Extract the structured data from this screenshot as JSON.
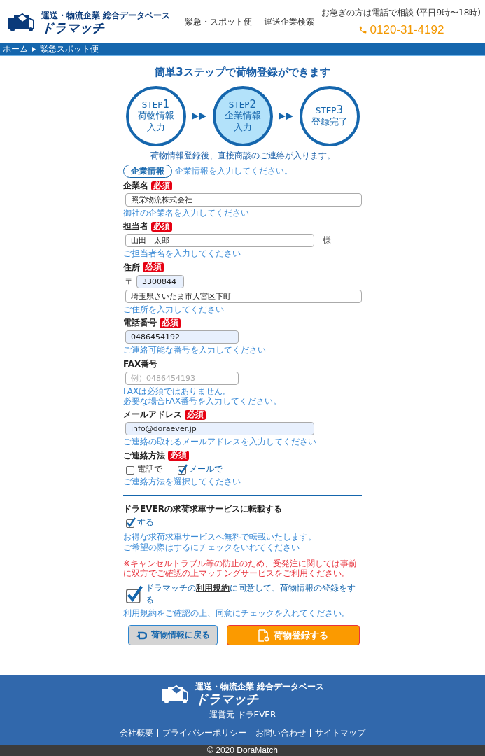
{
  "header": {
    "logo": {
      "tagline": "運送・物流企業 総合データベース",
      "name": "ドラマッチ"
    },
    "nav": [
      "緊急・スポット便",
      "運送企業検索"
    ],
    "contact": {
      "note": "お急ぎの方は電話で相談 (平日9時〜18時)",
      "phone": "0120-31-4192"
    }
  },
  "breadcrumb": [
    "ホーム",
    "緊急スポット便"
  ],
  "heading": "簡単3ステップで荷物登録ができます",
  "steps": [
    {
      "prefix": "STEP",
      "number": "1",
      "title": [
        "荷物情報",
        "入力"
      ],
      "selected": false
    },
    {
      "prefix": "STEP",
      "number": "2",
      "title": [
        "企業情報",
        "入力"
      ],
      "selected": true
    },
    {
      "prefix": "STEP",
      "number": "3",
      "title": [
        "登録完了"
      ],
      "selected": false
    }
  ],
  "step_note": "荷物情報登録後、直接商談のご連絡が入ります。",
  "section": {
    "title": "企業情報",
    "hint": "企業情報を入力してください。"
  },
  "fields": [
    {
      "label": "企業名",
      "badge": "必須",
      "inputs": [
        {
          "value": "照栄物流株式会社",
          "highlighted": false
        }
      ],
      "hints": [
        "御社の企業名を入力してください"
      ]
    },
    {
      "label": "担当者",
      "badge": "必須",
      "inputs": [
        {
          "value": "山田　太郎",
          "suffix": "様",
          "highlighted": false
        }
      ],
      "hints": [
        "ご担当者名を入力してください"
      ]
    },
    {
      "label": "住所",
      "badge": "必須",
      "inputs": [
        {
          "prefix": "〒",
          "value": "3300844",
          "highlighted": true
        },
        {
          "value": "埼玉県さいたま市大宮区下町",
          "highlighted": false
        }
      ],
      "hints": [
        "ご住所を入力してください"
      ]
    },
    {
      "label": "電話番号",
      "badge": "必須",
      "inputs": [
        {
          "value": "0486454192",
          "highlighted": true
        }
      ],
      "hints": [
        "ご連絡可能な番号を入力してください"
      ]
    },
    {
      "label": "FAX番号",
      "inputs": [
        {
          "placeholder": "例）0486454193",
          "highlighted": false
        }
      ],
      "hints": [
        "FAXは必須ではありません。",
        "必要な場合FAX番号を入力してください。"
      ]
    },
    {
      "label": "メールアドレス",
      "badge": "必須",
      "inputs": [
        {
          "value": "info@doraever.jp",
          "highlighted": true
        }
      ],
      "hints": [
        "ご連絡の取れるメールアドレスを入力してください"
      ]
    }
  ],
  "contact_method": {
    "label": "ご連絡方法",
    "badge": "必須",
    "options": [
      {
        "label": "電話で",
        "checked": false
      },
      {
        "label": "メールで",
        "checked": true
      }
    ],
    "hint": "ご連絡方法を選択してください"
  },
  "listing": {
    "title": "ドラEVERの求荷求車サービスに転載する",
    "option": {
      "label": "する",
      "checked": true
    },
    "hints": [
      "お得な求荷求車サービスへ無料で転載いたします。",
      "ご希望の際はするにチェックをいれてください"
    ],
    "warning": "※キャンセルトラブル等の防止のため、受発注に関しては事前に双方でご確認の上マッチングサービスをご利用ください。"
  },
  "agreement": {
    "checked": true,
    "before": "ドラマッチの",
    "link": "利用規約",
    "after": "に同意して、荷物情報の登録をする",
    "hint": "利用規約をご確認の上、同意にチェックを入れてください。"
  },
  "buttons": {
    "back": "荷物情報に戻る",
    "submit": "荷物登録する"
  },
  "footer": {
    "logo": {
      "tagline": "運送・物流企業 総合データベース",
      "name": "ドラマッチ"
    },
    "operator": "運営元 ドラEVER",
    "links": [
      "会社概要",
      "プライバシーポリシー",
      "お問い合わせ",
      "サイトマップ"
    ],
    "copyright": "© 2020 DoraMatch"
  }
}
